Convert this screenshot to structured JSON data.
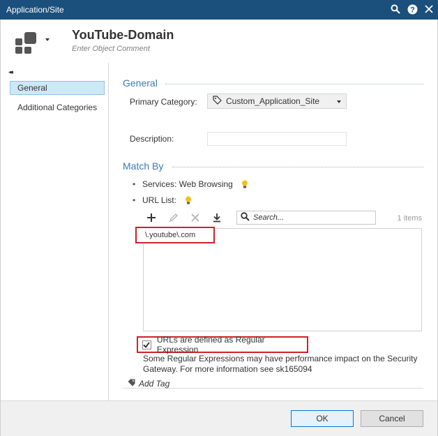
{
  "window": {
    "title": "Application/Site"
  },
  "header": {
    "name": "YouTube-Domain",
    "comment_placeholder": "Enter Object Comment"
  },
  "sidebar": {
    "items": [
      {
        "label": "General",
        "active": true
      },
      {
        "label": "Additional Categories",
        "active": false
      }
    ]
  },
  "general": {
    "title": "General",
    "primary_category_label": "Primary Category:",
    "primary_category_value": "Custom_Application_Site",
    "description_label": "Description:",
    "description_value": ""
  },
  "match_by": {
    "title": "Match By",
    "services_label": "Services: Web Browsing",
    "url_list_label": "URL List:",
    "search_placeholder": "Search...",
    "item_count": "1 items",
    "urls": [
      "\\.youtube\\.com"
    ],
    "regex_checkbox_label": "URLs are defined as Regular Expression",
    "regex_checked": true,
    "regex_note": "Some Regular Expressions may have performance impact on the Security Gateway. For more information see sk165094"
  },
  "add_tag_label": "Add Tag",
  "buttons": {
    "ok": "OK",
    "cancel": "Cancel"
  },
  "colors": {
    "titlebar": "#1b4f7c",
    "accent": "#3a7ab5",
    "highlight_red": "#d0202a",
    "selected_bg": "#cde8f7",
    "bulb": "#f2c316"
  },
  "icons": [
    "search-icon",
    "help-icon",
    "close-icon",
    "app-site-icon",
    "tag-icon",
    "lightbulb-icon",
    "plus-icon",
    "pencil-icon",
    "delete-icon",
    "import-icon"
  ]
}
